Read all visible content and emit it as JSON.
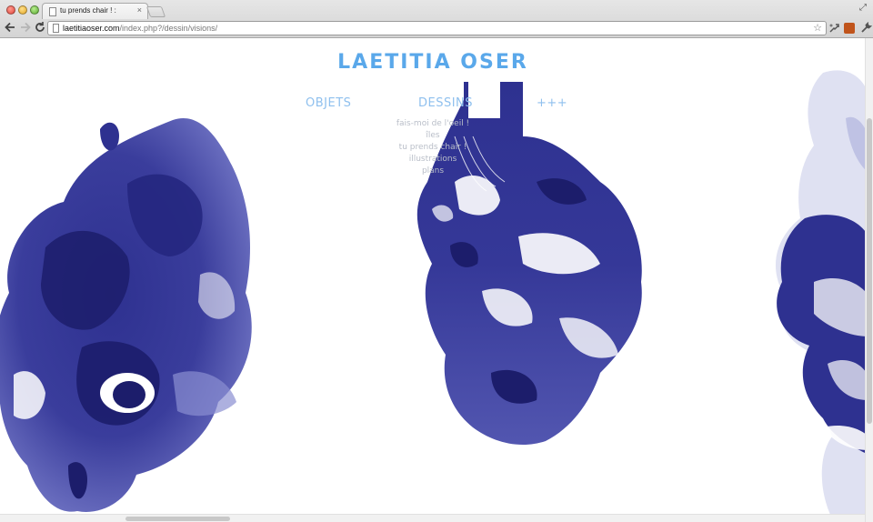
{
  "browser": {
    "tab_title": "tu prends chair ! :",
    "tab_close": "×",
    "url_host": "laetitiaoser.com",
    "url_path": "/index.php?/dessin/visions/",
    "fullscreen_glyph": "⤢",
    "star_glyph": "☆",
    "icons": [
      "back-arrow-icon",
      "forward-arrow-icon",
      "reload-icon",
      "page-icon",
      "bookmark-star-icon",
      "extension-icon",
      "wrench-icon"
    ]
  },
  "site": {
    "logo": "LAETITIA OSER",
    "menu": {
      "objets": "OBJETS",
      "dessins": "DESSINS",
      "more": "+++"
    },
    "submenu": [
      "fais-moi de l'oeil !",
      "îles",
      "tu prends chair !",
      "illustrations",
      "plans"
    ]
  },
  "colors": {
    "logo": "#5aa8ea",
    "menu": "#8fc0ee",
    "ink_dark": "#1c1d6b",
    "ink_mid": "#2e3190",
    "ink_light": "#5256b0"
  }
}
